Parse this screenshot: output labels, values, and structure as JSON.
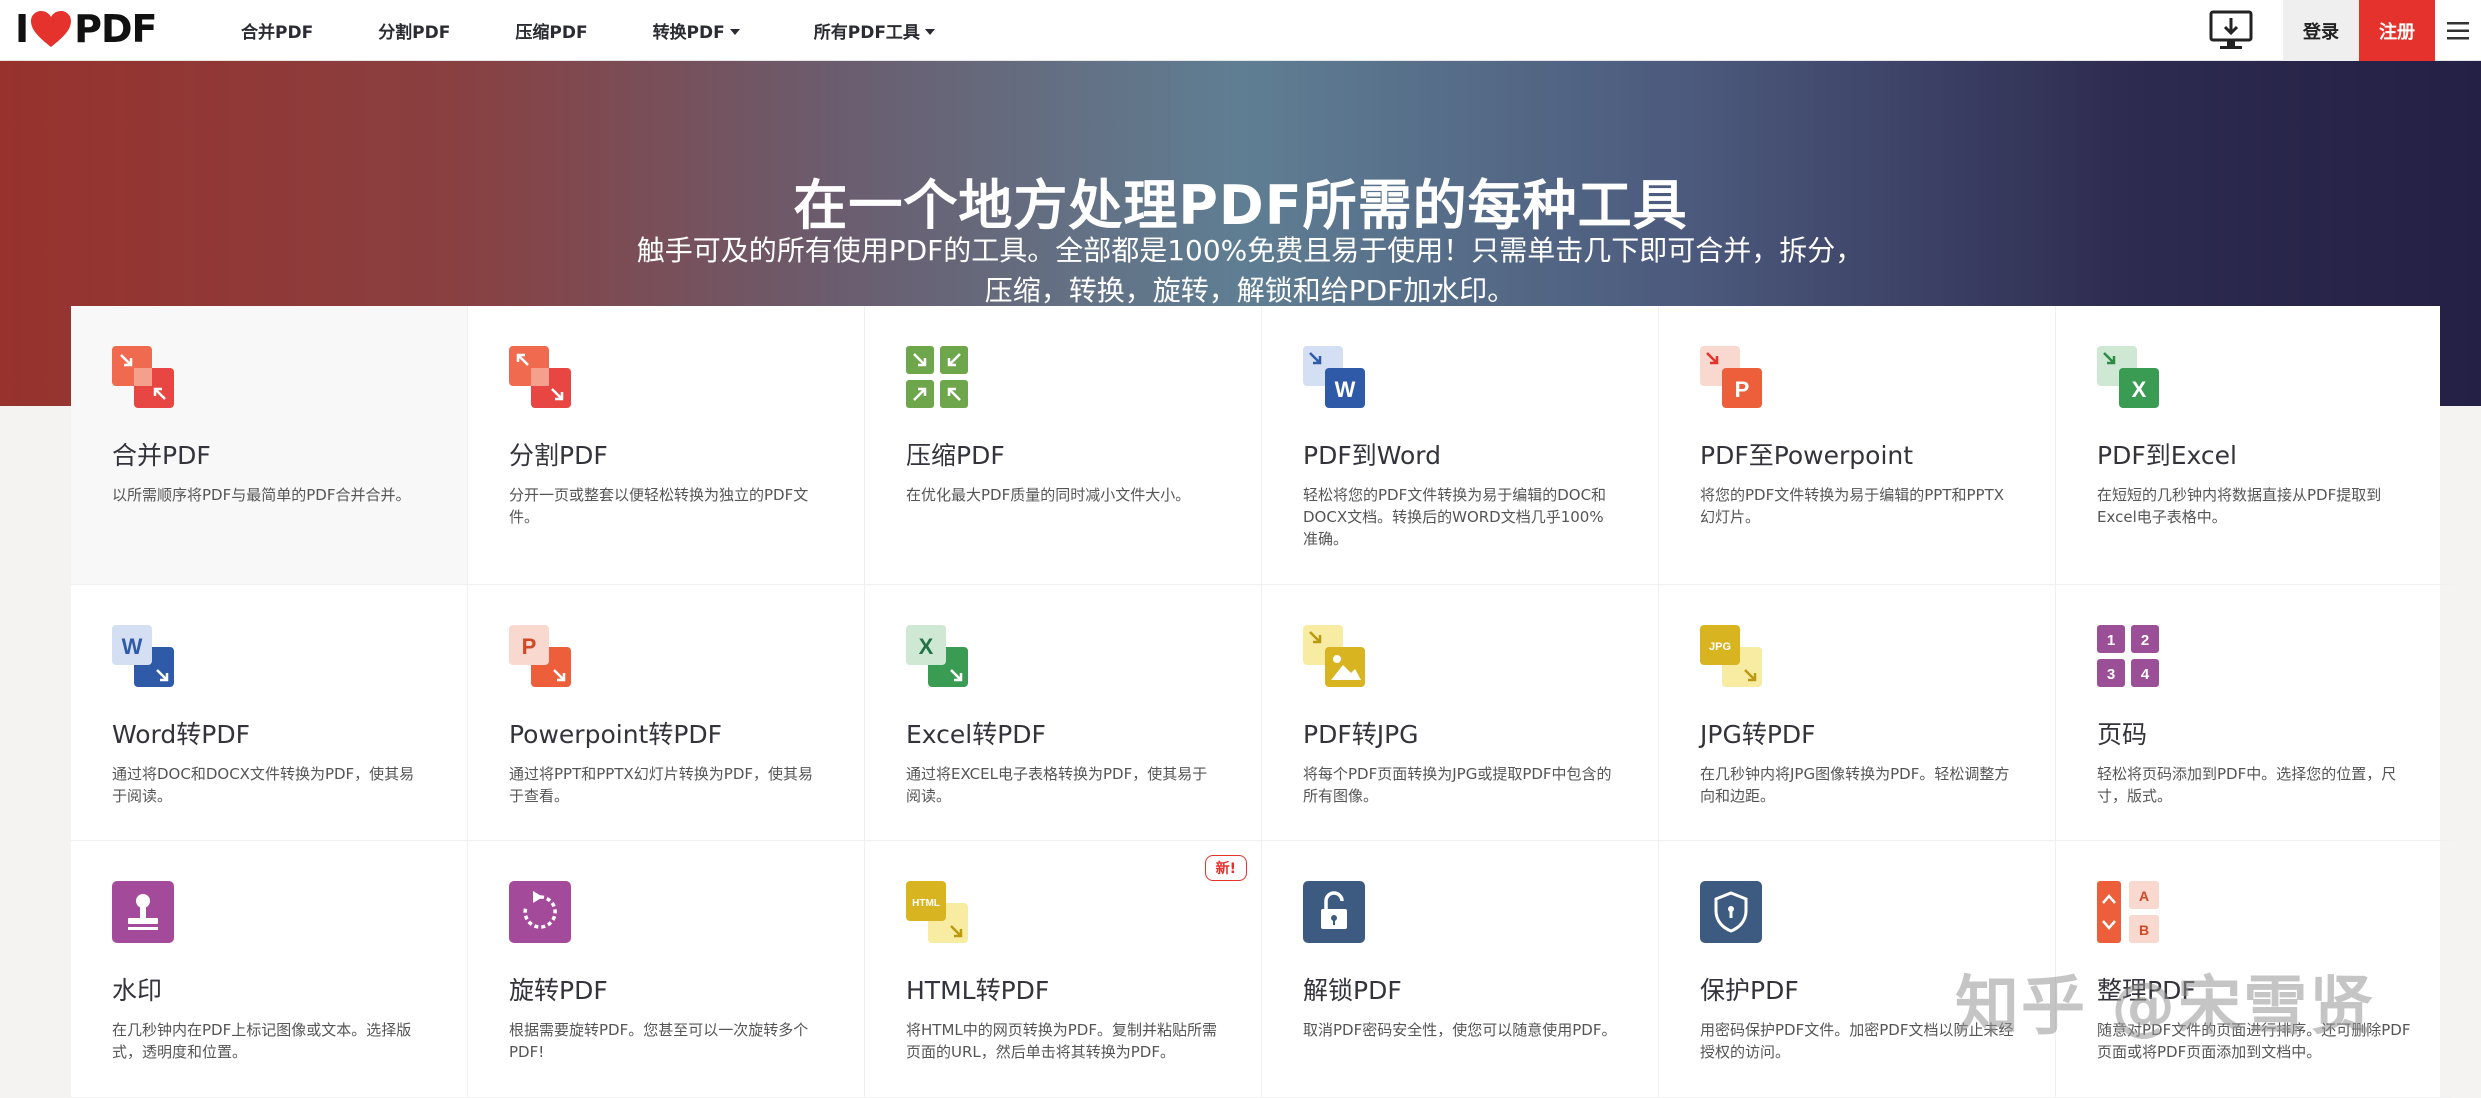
{
  "brand": {
    "logo_left": "I",
    "logo_right": "PDF",
    "color": "#e5322d"
  },
  "nav": {
    "items": [
      {
        "label": "合并PDF",
        "dropdown": false
      },
      {
        "label": "分割PDF",
        "dropdown": false
      },
      {
        "label": "压缩PDF",
        "dropdown": false
      },
      {
        "label": "转换PDF",
        "dropdown": true
      },
      {
        "label": "所有PDF工具",
        "dropdown": true
      }
    ],
    "login": "登录",
    "signup": "注册"
  },
  "hero": {
    "title": "在一个地方处理PDF所需的每种工具",
    "subtitle_line1": "触手可及的所有使用PDF的工具。全部都是100%免费且易于使用！只需单击几下即可合并，拆分，",
    "subtitle_line2": "压缩，转换，旋转，解锁和给PDF加水印。"
  },
  "tools": [
    {
      "title": "合并PDF",
      "desc": "以所需顺序将PDF与最简单的PDF合并合并。",
      "icon": "merge-icon"
    },
    {
      "title": "分割PDF",
      "desc": "分开一页或整套以便轻松转换为独立的PDF文件。",
      "icon": "split-icon"
    },
    {
      "title": "压缩PDF",
      "desc": "在优化最大PDF质量的同时减小文件大小。",
      "icon": "compress-icon"
    },
    {
      "title": "PDF到Word",
      "desc": "轻松将您的PDF文件转换为易于编辑的DOC和DOCX文档。转换后的WORD文档几乎100%准确。",
      "icon": "pdf-to-word-icon"
    },
    {
      "title": "PDF至Powerpoint",
      "desc": "将您的PDF文件转换为易于编辑的PPT和PPTX幻灯片。",
      "icon": "pdf-to-powerpoint-icon"
    },
    {
      "title": "PDF到Excel",
      "desc": "在短短的几秒钟内将数据直接从PDF提取到Excel电子表格中。",
      "icon": "pdf-to-excel-icon"
    },
    {
      "title": "Word转PDF",
      "desc": "通过将DOC和DOCX文件转换为PDF，使其易于阅读。",
      "icon": "word-to-pdf-icon"
    },
    {
      "title": "Powerpoint转PDF",
      "desc": "通过将PPT和PPTX幻灯片转换为PDF，使其易于查看。",
      "icon": "powerpoint-to-pdf-icon"
    },
    {
      "title": "Excel转PDF",
      "desc": "通过将EXCEL电子表格转换为PDF，使其易于阅读。",
      "icon": "excel-to-pdf-icon"
    },
    {
      "title": "PDF转JPG",
      "desc": "将每个PDF页面转换为JPG或提取PDF中包含的所有图像。",
      "icon": "pdf-to-jpg-icon"
    },
    {
      "title": "JPG转PDF",
      "desc": "在几秒钟内将JPG图像转换为PDF。轻松调整方向和边距。",
      "icon": "jpg-to-pdf-icon"
    },
    {
      "title": "页码",
      "desc": "轻松将页码添加到PDF中。选择您的位置，尺寸，版式。",
      "icon": "page-numbers-icon"
    },
    {
      "title": "水印",
      "desc": "在几秒钟内在PDF上标记图像或文本。选择版式，透明度和位置。",
      "icon": "watermark-icon"
    },
    {
      "title": "旋转PDF",
      "desc": "根据需要旋转PDF。您甚至可以一次旋转多个PDF!",
      "icon": "rotate-icon"
    },
    {
      "title": "HTML转PDF",
      "desc": "将HTML中的网页转换为PDF。复制并粘贴所需页面的URL，然后单击将其转换为PDF。",
      "icon": "html-to-pdf-icon",
      "badge": "新!"
    },
    {
      "title": "解锁PDF",
      "desc": "取消PDF密码安全性，使您可以随意使用PDF。",
      "icon": "unlock-icon"
    },
    {
      "title": "保护PDF",
      "desc": "用密码保护PDF文件。加密PDF文档以防止未经授权的访问。",
      "icon": "protect-icon"
    },
    {
      "title": "整理PDF",
      "desc": "随意对PDF文件的页面进行排序。还可删除PDF页面或将PDF页面添加到文档中。",
      "icon": "organize-icon"
    }
  ],
  "watermark": "知乎 @宋雪贤"
}
